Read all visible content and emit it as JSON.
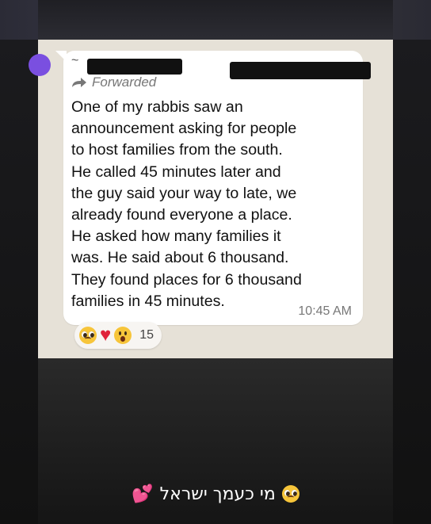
{
  "message": {
    "forwarded_label": "Forwarded",
    "body": "One of my rabbis saw an\nannouncement asking for people\nto host families from the south.\nHe called 45 minutes later and\nthe guy said your way to late, we\nalready found everyone a place.\nHe asked how many families it\nwas. He said about 6 thousand.\nThey found places for 6 thousand\nfamilies in 45 minutes.",
    "time": "10:45 AM"
  },
  "reactions": {
    "emojis": [
      "pleading-face",
      "red-heart",
      "face-with-open-mouth"
    ],
    "count": "15"
  },
  "caption": {
    "text": "מי כעמך ישראל",
    "leading_emoji": "pleading-face",
    "trailing_emoji": "two-hearts"
  },
  "colors": {
    "bubble": "#ffffff",
    "chat_background": "#e6e1d7",
    "heart": "#e0223a",
    "avatar": "#7a4fe0"
  }
}
